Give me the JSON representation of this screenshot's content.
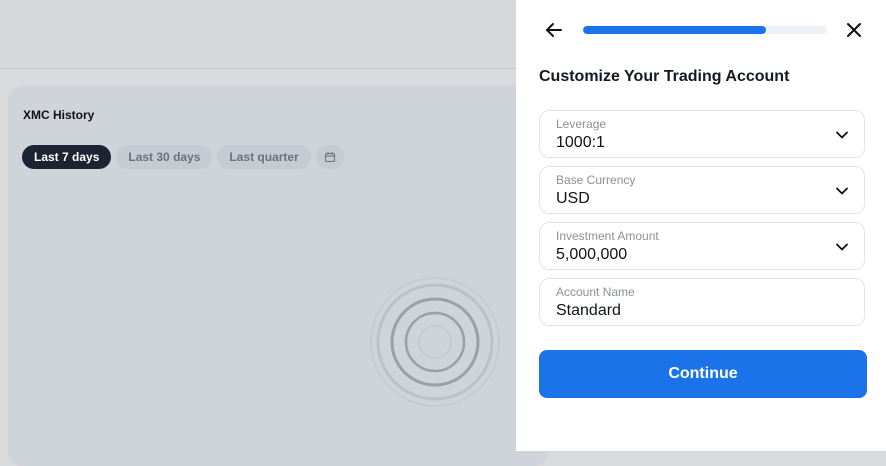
{
  "background": {
    "card_title": "XMC History",
    "filters": [
      {
        "label": "Last 7 days",
        "active": true
      },
      {
        "label": "Last 30 days",
        "active": false
      },
      {
        "label": "Last quarter",
        "active": false
      }
    ],
    "calendar_icon": "calendar-icon",
    "loading_icon": "spinner-icon"
  },
  "drawer": {
    "back_icon": "arrow-left-icon",
    "close_icon": "close-icon",
    "progress_fraction": 0.75,
    "title": "Customize Your Trading Account",
    "fields": [
      {
        "label": "Leverage",
        "value": "1000:1",
        "dropdown": true
      },
      {
        "label": "Base Currency",
        "value": "USD",
        "dropdown": true
      },
      {
        "label": "Investment Amount",
        "value": "5,000,000",
        "dropdown": true
      },
      {
        "label": "Account Name",
        "value": "Standard",
        "dropdown": false
      }
    ],
    "continue_label": "Continue",
    "accent_color": "#1a73e8"
  }
}
